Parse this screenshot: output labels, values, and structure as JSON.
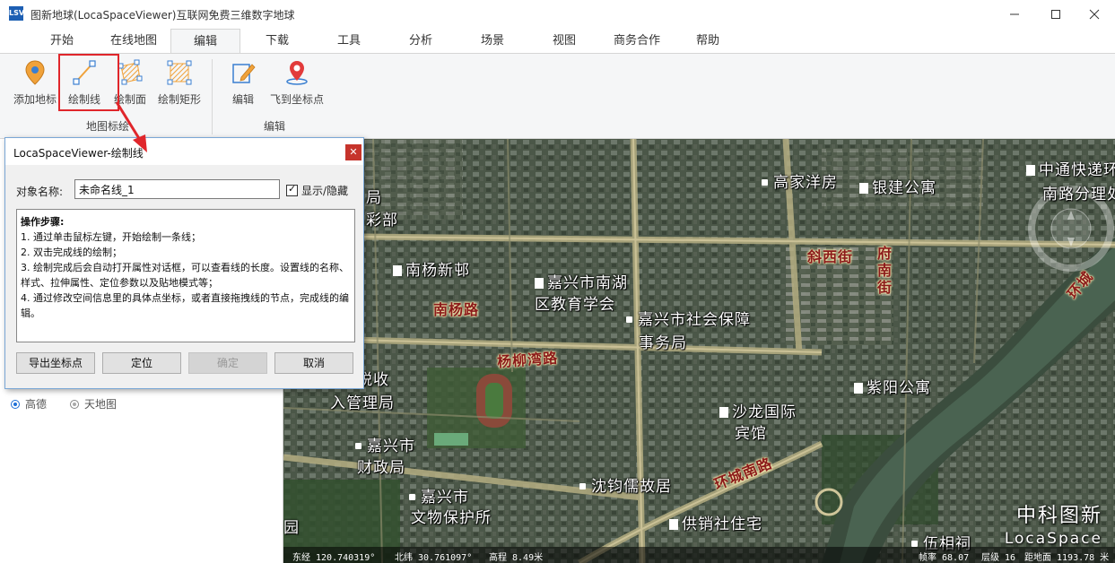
{
  "window": {
    "title": "图新地球(LocaSpaceViewer)互联网免费三维数字地球",
    "icon_text": "LSV",
    "controls": [
      "minimize-icon",
      "maximize-icon",
      "close-icon"
    ]
  },
  "ribbon_tabs": [
    {
      "label": "开始"
    },
    {
      "label": "在线地图"
    },
    {
      "label": "编辑",
      "active": true
    },
    {
      "label": "下载"
    },
    {
      "label": "工具"
    },
    {
      "label": "分析"
    },
    {
      "label": "场景"
    },
    {
      "label": "视图"
    },
    {
      "label": "商务合作"
    },
    {
      "label": "帮助"
    }
  ],
  "ribbon": {
    "groups": [
      {
        "label": "地图标绘",
        "buttons": [
          {
            "label": "添加地标",
            "icon": "placemark-icon"
          },
          {
            "label": "绘制线",
            "icon": "draw-line-icon",
            "highlighted": true
          },
          {
            "label": "绘制面",
            "icon": "draw-polygon-icon"
          },
          {
            "label": "绘制矩形",
            "icon": "draw-rectangle-icon"
          }
        ]
      },
      {
        "label": "编辑",
        "buttons": [
          {
            "label": "编辑",
            "icon": "edit-pencil-icon"
          },
          {
            "label": "飞到坐标点",
            "icon": "fly-to-point-icon"
          }
        ]
      }
    ]
  },
  "left_panel": {
    "radio_options": [
      {
        "label": "高德",
        "selected": true
      },
      {
        "label": "天地图",
        "selected": false
      }
    ]
  },
  "dialog": {
    "title": "LocaSpaceViewer-绘制线",
    "name_label": "对象名称:",
    "name_value": "未命名线_1",
    "show_hide_label": "显示/隐藏",
    "show_hide_checked": true,
    "steps_title": "操作步骤:",
    "steps": [
      "1. 通过单击鼠标左键，开始绘制一条线；",
      "2. 双击完成线的绘制；",
      "3. 绘制完成后会自动打开属性对话框，可以查看线的长度。设置线的名称、样式、拉伸属性、定位参数以及贴地模式等；",
      "4. 通过修改空间信息里的具体点坐标，或者直接拖拽线的节点，完成线的编辑。"
    ],
    "buttons": {
      "export": "导出坐标点",
      "locate": "定位",
      "ok": "确定",
      "cancel": "取消"
    }
  },
  "map": {
    "pois": [
      {
        "text": "高家洋房"
      },
      {
        "text": "银建公寓"
      },
      {
        "text": "中通快递环城"
      },
      {
        "text": "南路分理处"
      },
      {
        "text": "南杨新邨"
      },
      {
        "text": "嘉兴市南湖"
      },
      {
        "text": "区教育学会"
      },
      {
        "text": "嘉兴市社会保障"
      },
      {
        "text": "事务局"
      },
      {
        "text": "市非税收"
      },
      {
        "text": "入管理局"
      },
      {
        "text": "紫阳公寓"
      },
      {
        "text": "沙龙国际"
      },
      {
        "text": "宾馆"
      },
      {
        "text": "嘉兴市"
      },
      {
        "text": "财政局"
      },
      {
        "text": "沈钧儒故居"
      },
      {
        "text": "嘉兴市"
      },
      {
        "text": "文物保护所"
      },
      {
        "text": "供销社住宅"
      },
      {
        "text": "伍相祠"
      },
      {
        "text": "局"
      },
      {
        "text": "彩部"
      },
      {
        "text": "园"
      }
    ],
    "roads": [
      {
        "text": "斜西街"
      },
      {
        "text": "府南街"
      },
      {
        "text": "南杨路"
      },
      {
        "text": "杨柳湾路"
      },
      {
        "text": "环城南路"
      },
      {
        "text": "环城"
      }
    ],
    "status": {
      "lon": "东经 120.740319°",
      "lat": "北纬 30.761097°",
      "alt": "高程 8.49米",
      "frame": "帧率 68.07",
      "level": "层级 16",
      "distance": "距地面 1193.78 米"
    },
    "brand_cn": "中科图新",
    "brand_en": "LocaSpace"
  },
  "colors": {
    "accent": "#1e6fd6",
    "highlight": "#e0262b",
    "road_label": "#8b1a1a"
  }
}
